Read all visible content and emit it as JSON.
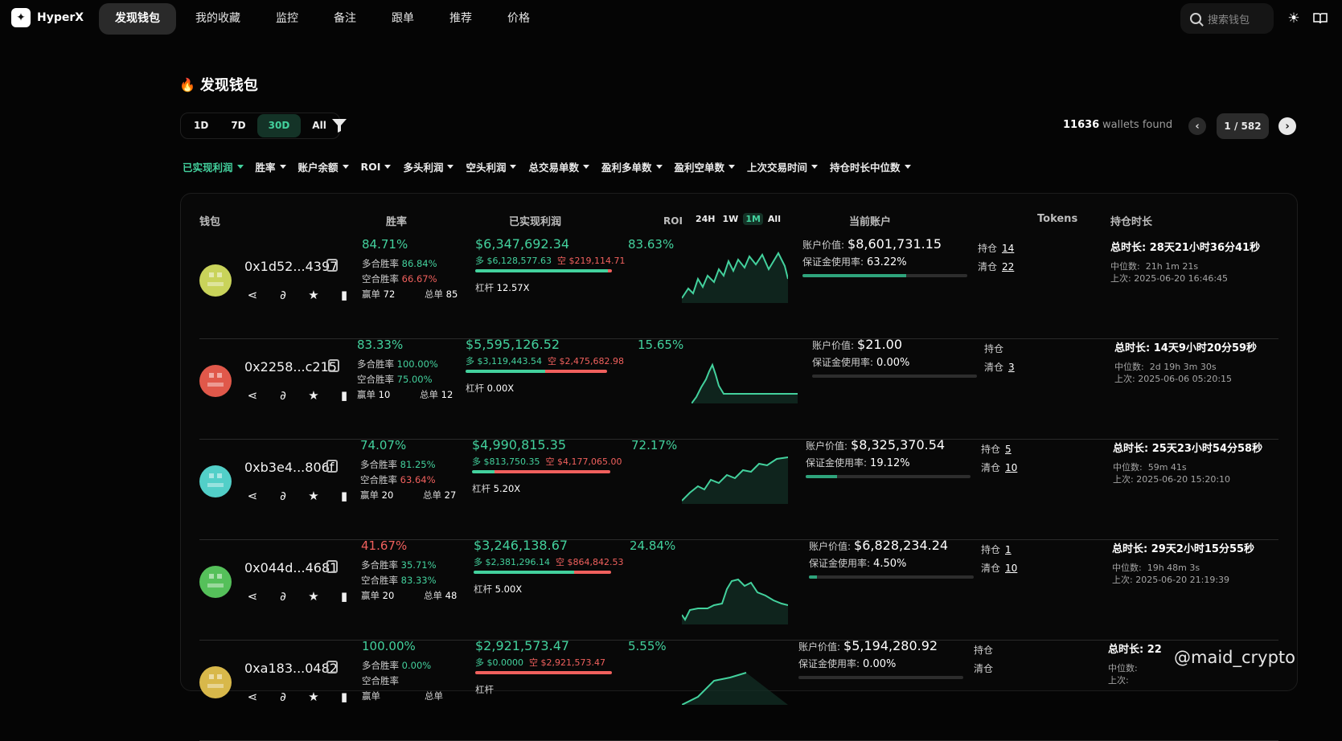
{
  "app": {
    "name": "HyperX"
  },
  "nav": [
    {
      "label": "发现钱包",
      "active": true
    },
    {
      "label": "我的收藏"
    },
    {
      "label": "监控"
    },
    {
      "label": "备注"
    },
    {
      "label": "跟单"
    },
    {
      "label": "推荐"
    },
    {
      "label": "价格"
    }
  ],
  "search": {
    "placeholder": "搜索钱包"
  },
  "page": {
    "title": "发现钱包"
  },
  "periods": [
    {
      "label": "1D"
    },
    {
      "label": "7D"
    },
    {
      "label": "30D",
      "active": true
    },
    {
      "label": "All"
    }
  ],
  "pagination": {
    "count": "11636",
    "label": "wallets found",
    "page": "1 / 582"
  },
  "sorts": [
    {
      "label": "已实现利润",
      "active": true
    },
    {
      "label": "胜率"
    },
    {
      "label": "账户余额"
    },
    {
      "label": "ROI"
    },
    {
      "label": "多头利润"
    },
    {
      "label": "空头利润"
    },
    {
      "label": "总交易单数"
    },
    {
      "label": "盈利多单数"
    },
    {
      "label": "盈利空单数"
    },
    {
      "label": "上次交易时间"
    },
    {
      "label": "持仓时长中位数"
    }
  ],
  "headers": {
    "wallet": "钱包",
    "winrate": "胜率",
    "pnl": "已实现利润",
    "roi": "ROI",
    "account": "当前账户",
    "tokens": "Tokens",
    "duration": "持仓时长"
  },
  "roi_tabs": [
    {
      "label": "24H"
    },
    {
      "label": "1W"
    },
    {
      "label": "1M",
      "active": true
    },
    {
      "label": "All"
    }
  ],
  "labels": {
    "long_rate": "多合胜率",
    "short_rate": "空合胜率",
    "win": "赢单",
    "total": "总单",
    "long": "多",
    "short": "空",
    "lev": "杠杆",
    "acct_value": "账户价值:",
    "margin": "保证金使用率:",
    "hold": "持仓",
    "closed": "清仓",
    "total_dur": "总时长:",
    "median": "中位数:",
    "last": "上次:"
  },
  "rows": [
    {
      "addr": "0x1d52...4397",
      "winrate": "84.71%",
      "winrate_color": "#43d19d",
      "long_rate": "86.84%",
      "short_rate": "66.67%",
      "short_color": "#f0605d",
      "win": "72",
      "total": "85",
      "pnl": "$6,347,692.34",
      "pnl_long": "$6,128,577.63",
      "pnl_short": "$219,114.71",
      "long_share": 0.966,
      "lev": "12.57X",
      "roi": "83.63%",
      "acct": "$8,601,731.15",
      "margin": "63.22%",
      "margin_frac": 0.6322,
      "hold": "14",
      "closed": "22",
      "dur": "28天21小时36分41秒",
      "median": "21h 1m 21s",
      "last": "2025-06-20 16:46:45",
      "avatar_color": "#c9d35a"
    },
    {
      "addr": "0x2258...c215",
      "winrate": "83.33%",
      "winrate_color": "#43d19d",
      "long_rate": "100.00%",
      "short_rate": "75.00%",
      "short_color": "#43d19d",
      "win": "10",
      "total": "12",
      "pnl": "$5,595,126.52",
      "pnl_long": "$3,119,443.54",
      "pnl_short": "$2,475,682.98",
      "long_share": 0.557,
      "lev": "0.00X",
      "roi": "15.65%",
      "acct": "$21.00",
      "margin": "0.00%",
      "margin_frac": 0,
      "hold": "",
      "closed": "3",
      "dur": "14天9小时20分59秒",
      "median": "2d 19h 3m 30s",
      "last": "2025-06-06 05:20:15",
      "avatar_color": "#e0584a"
    },
    {
      "addr": "0xb3e4...806f",
      "winrate": "74.07%",
      "winrate_color": "#43d19d",
      "long_rate": "81.25%",
      "short_rate": "63.64%",
      "short_color": "#f0605d",
      "win": "20",
      "total": "27",
      "pnl": "$4,990,815.35",
      "pnl_long": "$813,750.35",
      "pnl_short": "$4,177,065.00",
      "long_share": 0.163,
      "lev": "5.20X",
      "roi": "72.17%",
      "acct": "$8,325,370.54",
      "margin": "19.12%",
      "margin_frac": 0.1912,
      "hold": "5",
      "closed": "10",
      "dur": "25天23小时54分58秒",
      "median": "59m 41s",
      "last": "2025-06-20 15:20:10",
      "avatar_color": "#52cfc8"
    },
    {
      "addr": "0x044d...4681",
      "winrate": "41.67%",
      "winrate_color": "#f0605d",
      "long_rate": "35.71%",
      "short_rate": "83.33%",
      "short_color": "#43d19d",
      "win": "20",
      "total": "48",
      "pnl": "$3,246,138.67",
      "pnl_long": "$2,381,296.14",
      "pnl_short": "$864,842.53",
      "long_share": 0.734,
      "lev": "5.00X",
      "roi": "24.84%",
      "acct": "$6,828,234.24",
      "margin": "4.50%",
      "margin_frac": 0.045,
      "hold": "1",
      "closed": "10",
      "dur": "29天2小时15分55秒",
      "median": "19h 48m 3s",
      "last": "2025-06-20 21:19:39",
      "avatar_color": "#55c05a"
    },
    {
      "addr": "0xa183...0482",
      "winrate": "100.00%",
      "winrate_color": "#43d19d",
      "long_rate": "0.00%",
      "short_rate": "",
      "short_color": "#43d19d",
      "win": "",
      "total": "",
      "pnl": "$2,921,573.47",
      "pnl_long": "$0.0000",
      "pnl_short": "$2,921,573.47",
      "long_share": 0,
      "lev": "",
      "roi": "5.55%",
      "acct": "$5,194,280.92",
      "margin": "0.00%",
      "margin_frac": 0,
      "hold": "",
      "closed": "",
      "dur": "22",
      "median": "",
      "last": "",
      "avatar_color": "#d8b84a"
    }
  ],
  "watermark": "@maid_crypto",
  "colors": {
    "accent": "#43d19d",
    "negative": "#f0605d"
  }
}
